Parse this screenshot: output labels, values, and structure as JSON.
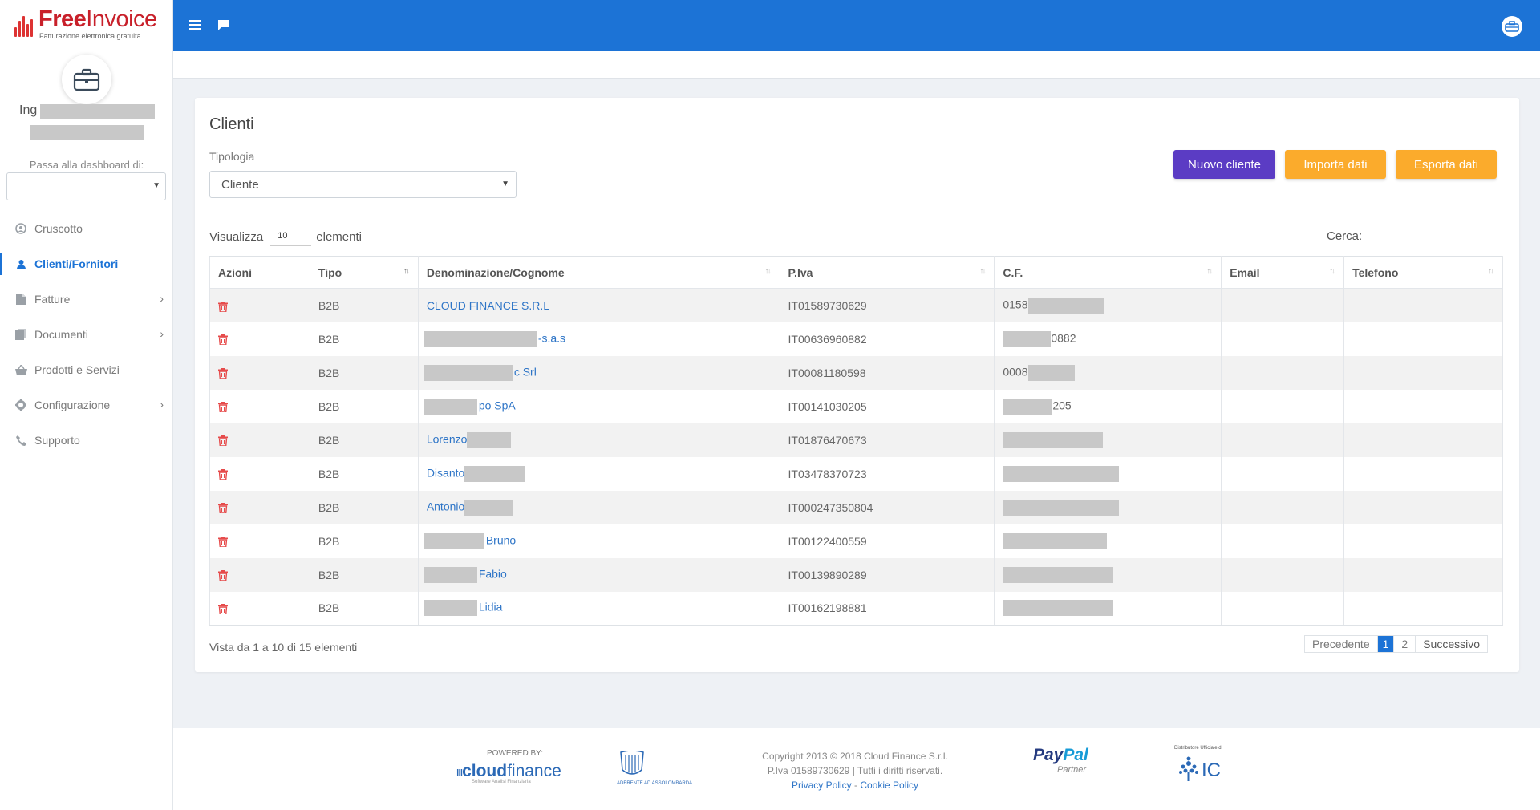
{
  "brand": {
    "name_bold": "Free",
    "name_light": "Invoice",
    "tagline": "Fatturazione elettronica gratuita"
  },
  "user": {
    "prefix": "Ing"
  },
  "dashboard_switch": {
    "label": "Passa alla dashboard di:",
    "value": ""
  },
  "nav": {
    "items": [
      {
        "label": "Cruscotto",
        "icon": "dashboard-icon"
      },
      {
        "label": "Clienti/Fornitori",
        "icon": "user-icon",
        "active": true
      },
      {
        "label": "Fatture",
        "icon": "file-icon",
        "has_children": true
      },
      {
        "label": "Documenti",
        "icon": "documents-icon",
        "has_children": true
      },
      {
        "label": "Prodotti e Servizi",
        "icon": "basket-icon"
      },
      {
        "label": "Configurazione",
        "icon": "gear-icon",
        "has_children": true
      },
      {
        "label": "Supporto",
        "icon": "phone-icon"
      }
    ]
  },
  "page": {
    "title": "Clienti",
    "tipologia_label": "Tipologia",
    "tipologia_value": "Cliente",
    "buttons": {
      "new": "Nuovo cliente",
      "import": "Importa dati",
      "export": "Esporta dati"
    },
    "length_prefix": "Visualizza",
    "length_value": "10",
    "length_suffix": "elementi",
    "search_label": "Cerca:",
    "search_value": ""
  },
  "table": {
    "columns": [
      "Azioni",
      "Tipo",
      "Denominazione/Cognome",
      "P.Iva",
      "C.F.",
      "Email",
      "Telefono"
    ],
    "rows": [
      {
        "tipo": "B2B",
        "name_pre": "",
        "name": "CLOUD FINANCE S.R.L",
        "piva": "IT01589730629",
        "cf": "0158",
        "email": "",
        "telefono": ""
      },
      {
        "tipo": "B2B",
        "name_pre": "",
        "name": "-s.a.s",
        "piva": "IT00636960882",
        "cf": "0882",
        "email": "",
        "telefono": ""
      },
      {
        "tipo": "B2B",
        "name_pre": "",
        "name": "c Srl",
        "piva": "IT00081180598",
        "cf": "0008",
        "email": "",
        "telefono": ""
      },
      {
        "tipo": "B2B",
        "name_pre": "",
        "name": "po SpA",
        "piva": "IT00141030205",
        "cf": "205",
        "email": "",
        "telefono": ""
      },
      {
        "tipo": "B2B",
        "name_pre": "Lorenzo",
        "name": "",
        "piva": "IT01876470673",
        "cf": "",
        "email": "",
        "telefono": ""
      },
      {
        "tipo": "B2B",
        "name_pre": "Disanto",
        "name": "",
        "piva": "IT03478370723",
        "cf": "",
        "email": "",
        "telefono": ""
      },
      {
        "tipo": "B2B",
        "name_pre": "Antonio",
        "name": "",
        "piva": "IT000247350804",
        "cf": "",
        "email": "",
        "telefono": ""
      },
      {
        "tipo": "B2B",
        "name_pre": "",
        "name": "Bruno",
        "piva": "IT00122400559",
        "cf": "",
        "email": "",
        "telefono": ""
      },
      {
        "tipo": "B2B",
        "name_pre": "",
        "name": "Fabio",
        "piva": "IT00139890289",
        "cf": "",
        "email": "",
        "telefono": ""
      },
      {
        "tipo": "B2B",
        "name_pre": "",
        "name": "Lidia",
        "piva": "IT00162198881",
        "cf": "",
        "email": "",
        "telefono": ""
      }
    ],
    "info": "Vista da 1 a 10 di 15 elementi"
  },
  "pagination": {
    "prev": "Precedente",
    "pages": [
      "1",
      "2"
    ],
    "current": "1",
    "next": "Successivo"
  },
  "footer": {
    "powered_by": "POWERED BY:",
    "cloudfinance_bold": "cloud",
    "cloudfinance_light": "finance",
    "cloudfinance_sub": "Software Analisi Finanziaria",
    "assolombarda": "ADERENTE AD ASSOLOMBARDA",
    "copyright_line1": "Copyright 2013 © 2018 Cloud Finance S.r.l.",
    "copyright_line2": "P.Iva 01589730629 | Tutti i diritti riservati.",
    "privacy": "Privacy Policy",
    "sep": " - ",
    "cookie": "Cookie Policy",
    "paypal_pay": "Pay",
    "paypal_pal": "Pal",
    "paypal_sub": "Partner",
    "ic_top": "Distributore Ufficiale di",
    "ic": "IC"
  },
  "colors": {
    "primary": "#1c73d6",
    "purple": "#5b3cc4",
    "orange": "#fbab2c",
    "danger": "#e64b4b"
  }
}
